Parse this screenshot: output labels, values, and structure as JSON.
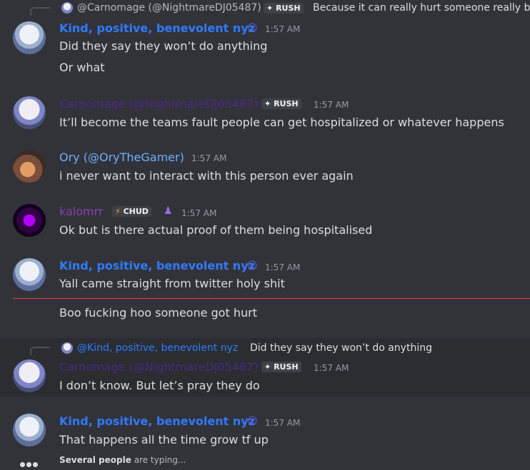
{
  "messages": {
    "m1": {
      "reply": {
        "author": "@Carnomage (@NightmareDJ05487)",
        "tag": "RUSH",
        "text": "Because it can really hurt someone really ba"
      },
      "author": "Kind, positive, benevolent nyz",
      "time": "1:57 AM",
      "lines": [
        "Did they say they won’t do anything",
        "Or what"
      ]
    },
    "m2": {
      "author": "Carnomage (@NightmareDJ05487)",
      "tag": "RUSH",
      "time": "1:57 AM",
      "lines": [
        "It’ll become the teams fault people can get hospitalized or whatever happens"
      ]
    },
    "m3": {
      "author": "Ory (@OryTheGamer)",
      "time": "1:57 AM",
      "lines": [
        "i never want to interact with this person ever again"
      ]
    },
    "m4": {
      "author": "kalomrr",
      "tag": "CHUD",
      "time": "1:57 AM",
      "lines": [
        "Ok but is there actual proof of them being hospitalised"
      ]
    },
    "m5": {
      "author": "Kind, positive, benevolent nyz",
      "time": "1:57 AM",
      "lines": [
        "Yall came straight from twitter holy shit",
        "Boo fucking hoo someone got hurt"
      ]
    },
    "m6": {
      "reply": {
        "author": "@Kind, positive, benevolent nyz",
        "text": "Did they say they won’t do anything"
      },
      "author": "Carnomage (@NightmareDJ05487)",
      "tag": "RUSH",
      "time": "1:57 AM",
      "lines": [
        "I don’t know. But let’s pray they do"
      ]
    },
    "m7": {
      "author": "Kind, positive, benevolent nyz",
      "time": "1:57 AM",
      "lines": [
        "That happens all the time grow tf up"
      ]
    }
  },
  "typing": {
    "who": "Several people",
    "suffix": "are typing..."
  },
  "icons": {
    "tag_icon": "sparkle-icon",
    "role_icon": "emoji-icon",
    "chud_icon": "lightning-icon"
  },
  "colors": {
    "kind_name": "#2f7bff",
    "carno_name": "#4a2a85",
    "ory_name": "#6fb0ff",
    "kalo_name": "#8b3fb4",
    "new_divider": "#f23f43"
  }
}
